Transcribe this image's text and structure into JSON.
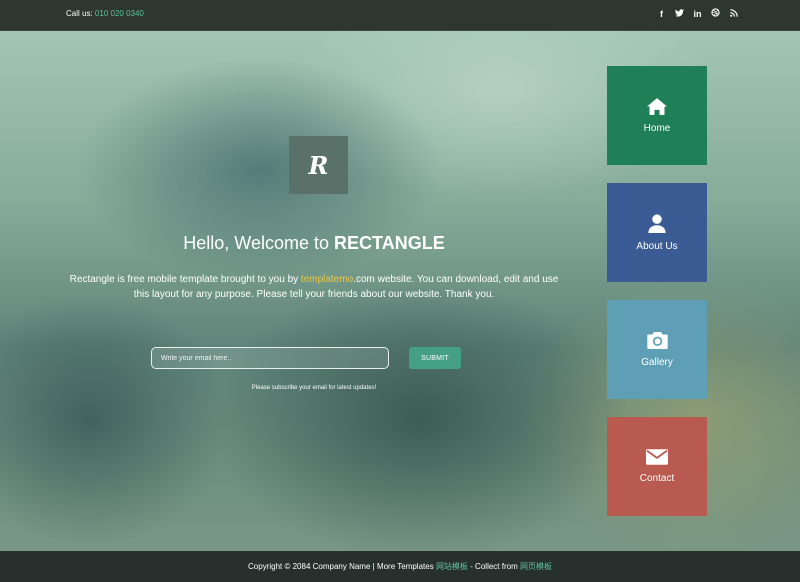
{
  "topbar": {
    "call_label": "Call us:",
    "call_number": "010 020 0340",
    "social": [
      "facebook-icon",
      "twitter-icon",
      "linkedin-icon",
      "dribbble-icon",
      "rss-icon"
    ]
  },
  "hero": {
    "logo_letter": "R",
    "welcome_prefix": "Hello, Welcome to",
    "welcome_brand": "RECTANGLE",
    "desc_before_link": "Rectangle is free mobile template brought to you by",
    "desc_link": "templatemo",
    "desc_after_link": ".com website. You can download, edit and use this layout for any purpose. Please tell your friends about our website. Thank you.",
    "email_placeholder": "Write your email here..",
    "submit_label": "SUBMIT",
    "subscribe_note": "Please subscribe your email for latest updates!"
  },
  "nav": {
    "home": {
      "label": "Home",
      "icon": "home-icon",
      "color": "#1f7f57"
    },
    "about": {
      "label": "About Us",
      "icon": "user-icon",
      "color": "#3a5b94"
    },
    "gallery": {
      "label": "Gallery",
      "icon": "camera-icon",
      "color": "#5e9fb5"
    },
    "contact": {
      "label": "Contact",
      "icon": "envelope-icon",
      "color": "#b85a50"
    }
  },
  "footer": {
    "copyright": "Copyright © 2084 Company Name | More Templates",
    "link1": "网站模板",
    "middle": "- Collect from",
    "link2": "网页模板"
  },
  "colors": {
    "accent": "#45a083",
    "link_yellow": "#e6c84a"
  }
}
